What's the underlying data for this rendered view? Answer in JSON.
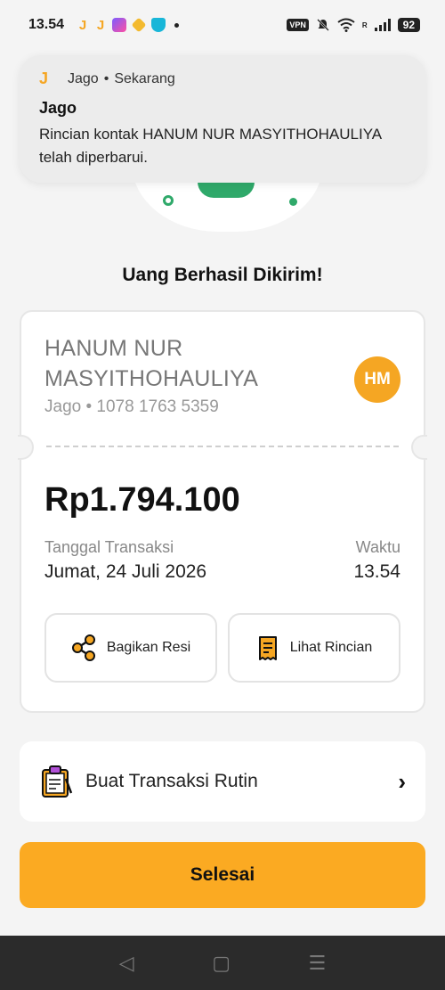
{
  "status_bar": {
    "time": "13.54",
    "vpn_label": "VPN",
    "network_label": "R",
    "battery": "92"
  },
  "notification": {
    "app_name": "Jago",
    "separator": "•",
    "when": "Sekarang",
    "title": "Jago",
    "body": "Rincian kontak HANUM NUR MASYITHOHAULIYA telah diperbarui.",
    "icon": "jago-j-icon"
  },
  "headline": "Uang Berhasil Dikirim!",
  "receipt": {
    "recipient_name": "HANUM NUR MASYITHOHAULIYA",
    "recipient_account": "Jago • 1078 1763 5359",
    "avatar_initials": "HM",
    "amount": "Rp1.794.100",
    "date_label": "Tanggal Transaksi",
    "date_value": "Jumat, 24 Juli 2026",
    "time_label": "Waktu",
    "time_value": "13.54",
    "share_button": "Bagikan Resi",
    "detail_button": "Lihat Rincian"
  },
  "routine": {
    "label": "Buat Transaksi Rutin",
    "chevron": "›"
  },
  "done_button": "Selesai",
  "nav": {
    "back": "◁",
    "home": "▢",
    "recents": "☰"
  },
  "colors": {
    "accent": "#fbaa22",
    "brand_orange": "#f5a623",
    "green": "#2fa96a",
    "background": "#f4f4f4"
  }
}
